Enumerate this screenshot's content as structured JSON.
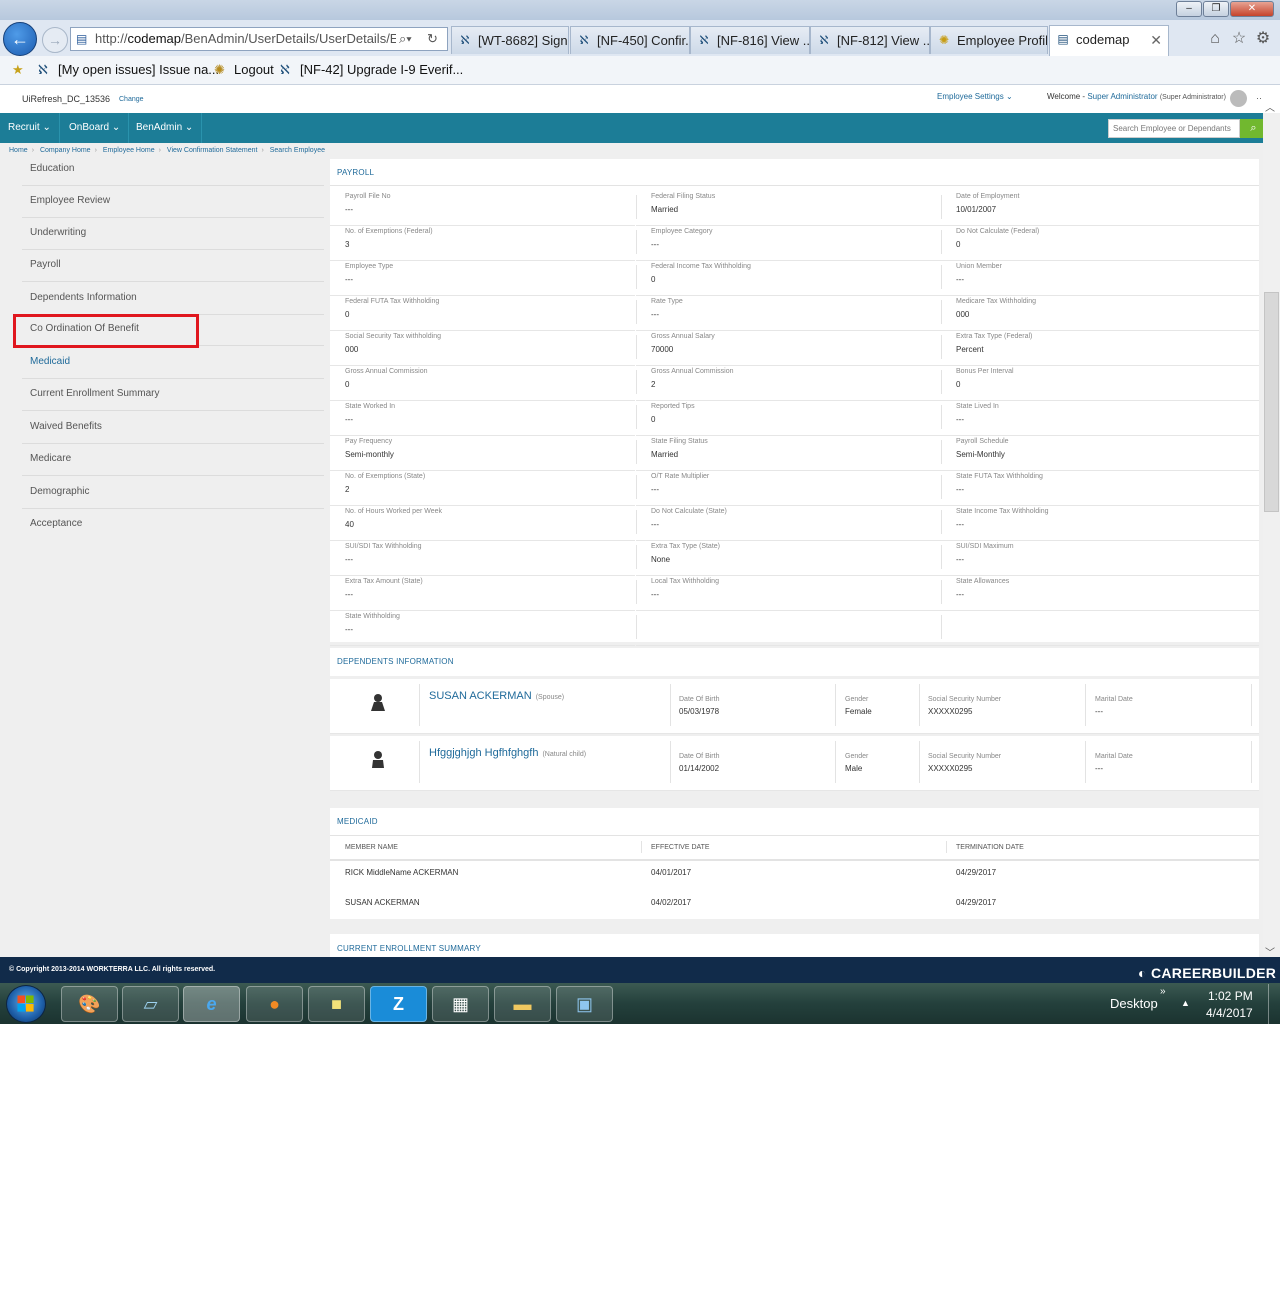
{
  "browser": {
    "window_title": "",
    "address_url_prefix": "http://",
    "address_url_host": "codemap",
    "address_url_path": "/BenAdmin/UserDetails/UserDetails/Enr",
    "tabs": [
      {
        "label": "[WT-8682] Sign..."
      },
      {
        "label": "[NF-450] Confir..."
      },
      {
        "label": "[NF-816] View ..."
      },
      {
        "label": "[NF-812] View ..."
      },
      {
        "label": "Employee Profile"
      },
      {
        "label": "codemap"
      }
    ],
    "favorites": [
      {
        "label": "[My open issues] Issue na..."
      },
      {
        "label": "Logout"
      },
      {
        "label": "[NF-42] Upgrade I-9 Everif..."
      }
    ]
  },
  "header": {
    "client": "UiRefresh_DC_13536",
    "change": "Change",
    "employee_settings": "Employee Settings",
    "welcome": "Welcome -",
    "user": "Super Administrator",
    "role": "(Super Administrator)"
  },
  "nav": {
    "items": [
      {
        "label": "Recruit"
      },
      {
        "label": "OnBoard"
      },
      {
        "label": "BenAdmin"
      }
    ],
    "search_placeholder": "Search Employee or Dependants"
  },
  "breadcrumb": [
    "Home",
    "Company Home",
    "Employee Home",
    "View Confirmation Statement",
    "Search Employee"
  ],
  "sidebar": {
    "items": [
      {
        "label": "Education"
      },
      {
        "label": "Employee Review"
      },
      {
        "label": "Underwriting"
      },
      {
        "label": "Payroll"
      },
      {
        "label": "Dependents Information"
      },
      {
        "label": "Co Ordination Of Benefit"
      },
      {
        "label": "Medicaid"
      },
      {
        "label": "Current Enrollment Summary"
      },
      {
        "label": "Waived Benefits"
      },
      {
        "label": "Medicare"
      },
      {
        "label": "Demographic"
      },
      {
        "label": "Acceptance"
      }
    ]
  },
  "payroll": {
    "title": "PAYROLL",
    "fields": [
      {
        "label": "Payroll File No",
        "value": "---"
      },
      {
        "label": "Federal Filing Status",
        "value": "Married"
      },
      {
        "label": "Date of Employment",
        "value": "10/01/2007"
      },
      {
        "label": "No. of Exemptions (Federal)",
        "value": "3"
      },
      {
        "label": "Employee Category",
        "value": "---"
      },
      {
        "label": "Do Not Calculate (Federal)",
        "value": "0"
      },
      {
        "label": "Employee Type",
        "value": "---"
      },
      {
        "label": "Federal Income Tax Withholding",
        "value": "0"
      },
      {
        "label": "Union Member",
        "value": "---"
      },
      {
        "label": "Federal FUTA Tax Withholding",
        "value": "0"
      },
      {
        "label": "Rate Type",
        "value": "---"
      },
      {
        "label": "Medicare Tax Withholding",
        "value": "000"
      },
      {
        "label": "Social Security Tax withholding",
        "value": "000"
      },
      {
        "label": "Gross Annual Salary",
        "value": "70000"
      },
      {
        "label": "Extra Tax Type (Federal)",
        "value": "Percent"
      },
      {
        "label": "Gross Annual Commission",
        "value": "0"
      },
      {
        "label": "Gross Annual Commission",
        "value": "2"
      },
      {
        "label": "Bonus Per Interval",
        "value": "0"
      },
      {
        "label": "State Worked In",
        "value": "---"
      },
      {
        "label": "Reported Tips",
        "value": "0"
      },
      {
        "label": "State Lived In",
        "value": "---"
      },
      {
        "label": "Pay Frequency",
        "value": "Semi-monthly"
      },
      {
        "label": "State Filing Status",
        "value": "Married"
      },
      {
        "label": "Payroll Schedule",
        "value": "Semi-Monthly"
      },
      {
        "label": "No. of Exemptions (State)",
        "value": "2"
      },
      {
        "label": "O/T Rate Multiplier",
        "value": "---"
      },
      {
        "label": "State FUTA Tax Withholding",
        "value": "---"
      },
      {
        "label": "No. of Hours Worked per Week",
        "value": "40"
      },
      {
        "label": "Do Not Calculate (State)",
        "value": "---"
      },
      {
        "label": "State Income Tax Withholding",
        "value": "---"
      },
      {
        "label": "SUI/SDI Tax Withholding",
        "value": "---"
      },
      {
        "label": "Extra Tax Type (State)",
        "value": "None"
      },
      {
        "label": "SUI/SDI Maximum",
        "value": "---"
      },
      {
        "label": "Extra Tax Amount (State)",
        "value": "---"
      },
      {
        "label": "Local Tax Withholding",
        "value": "---"
      },
      {
        "label": "State Allowances",
        "value": "---"
      },
      {
        "label": "State Withholding",
        "value": "---"
      }
    ]
  },
  "dependents": {
    "title": "DEPENDENTS INFORMATION",
    "labels": {
      "dob": "Date Of Birth",
      "gender": "Gender",
      "ssn": "Social Security Number",
      "marital": "Marital Date"
    },
    "rows": [
      {
        "name": "SUSAN ACKERMAN",
        "relation": "(Spouse)",
        "dob": "05/03/1978",
        "gender": "Female",
        "ssn": "XXXXX0295",
        "marital": "---"
      },
      {
        "name": "Hfggjghjgh Hgfhfghgfh",
        "relation": "(Natural child)",
        "dob": "01/14/2002",
        "gender": "Male",
        "ssn": "XXXXX0295",
        "marital": "---"
      }
    ]
  },
  "medicaid": {
    "title": "MEDICAID",
    "headers": {
      "member": "MEMBER NAME",
      "effective": "EFFECTIVE DATE",
      "termination": "TERMINATION DATE"
    },
    "rows": [
      {
        "member": "RICK MiddleName ACKERMAN",
        "effective": "04/01/2017",
        "termination": "04/29/2017"
      },
      {
        "member": "SUSAN ACKERMAN",
        "effective": "04/02/2017",
        "termination": "04/29/2017"
      }
    ]
  },
  "enrollment": {
    "title": "CURRENT ENROLLMENT SUMMARY"
  },
  "footer": {
    "copyright": "© Copyright 2013-2014 WORKTERRA LLC. All rights reserved.",
    "brand": "CAREERBUILDER"
  },
  "taskbar": {
    "desktop": "Desktop",
    "time": "1:02 PM",
    "date": "4/4/2017"
  }
}
